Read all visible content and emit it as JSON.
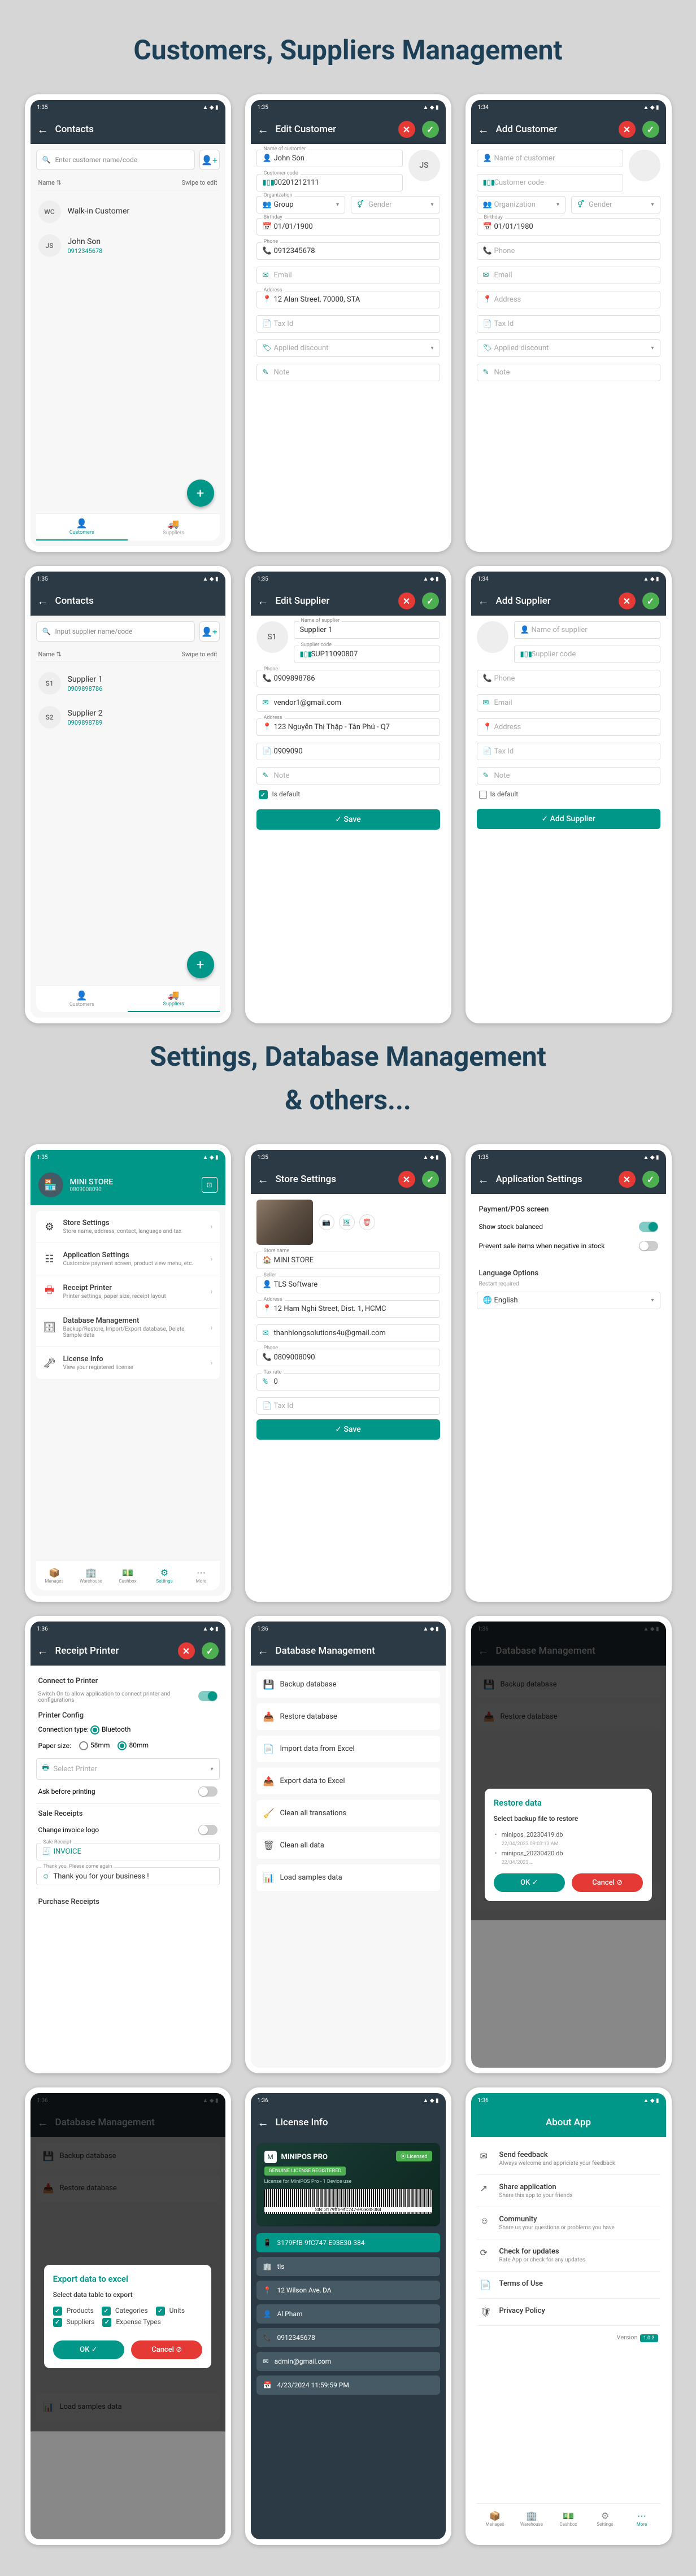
{
  "headers": {
    "section1": "Customers, Suppliers Management",
    "section2a": "Settings, Database Management",
    "section2b": "& others..."
  },
  "status": {
    "time": "1:35",
    "time2": "1:34",
    "time3": "1:36"
  },
  "contacts": {
    "title": "Contacts",
    "searchCustomer": "Enter customer name/code",
    "searchSupplier": "Input supplier name/code",
    "sortName": "Name ⇅",
    "swipe": "Swipe to edit",
    "customers": [
      {
        "initials": "WC",
        "name": "Walk-in Customer",
        "sub": ""
      },
      {
        "initials": "JS",
        "name": "John Son",
        "sub": "0912345678"
      }
    ],
    "suppliers": [
      {
        "initials": "S1",
        "name": "Supplier 1",
        "sub": "0909898786"
      },
      {
        "initials": "S2",
        "name": "Supplier 2",
        "sub": "0909898789"
      }
    ],
    "tabCustomers": "Customers",
    "tabSuppliers": "Suppliers"
  },
  "editCustomer": {
    "title": "Edit Customer",
    "name": "John Son",
    "code": "00201212111",
    "org": "Group",
    "gender": "Gender",
    "birthday": "01/01/1900",
    "phone": "0912345678",
    "email": "Email",
    "address": "12 Alan Street, 70000, STA",
    "taxId": "Tax Id",
    "discount": "Applied discount",
    "note": "Note",
    "avatar": "JS"
  },
  "addCustomer": {
    "title": "Add Customer",
    "name": "Name of customer",
    "code": "Customer code",
    "org": "Organization",
    "gender": "Gender",
    "birthday": "01/01/1980",
    "phone": "Phone",
    "email": "Email",
    "address": "Address",
    "taxId": "Tax Id",
    "discount": "Applied discount",
    "note": "Note"
  },
  "editSupplier": {
    "title": "Edit Supplier",
    "name": "Supplier 1",
    "code": "SUP11090807",
    "phone": "0909898786",
    "email": "vendor1@gmail.com",
    "address": "123 Nguyễn Thị Thập - Tân Phú - Q7",
    "taxId": "0909090",
    "note": "Note",
    "isDefault": "Is default",
    "save": "✓ Save",
    "avatar": "S1"
  },
  "addSupplier": {
    "title": "Add Supplier",
    "name": "Name of supplier",
    "code": "Supplier code",
    "phone": "Phone",
    "email": "Email",
    "address": "Address",
    "taxId": "Tax Id",
    "note": "Note",
    "isDefault": "Is default",
    "btn": "✓ Add Supplier"
  },
  "settings": {
    "store": "MINI STORE",
    "storeSub": "0809008090",
    "items": [
      {
        "icon": "⚙",
        "title": "Store Settings",
        "desc": "Store name, address, contact, language and tax"
      },
      {
        "icon": "☷",
        "title": "Application Settings",
        "desc": "Customize payment screen, product view menu, etc."
      },
      {
        "icon": "🖶",
        "title": "Receipt Printer",
        "desc": "Printer settings, paper size, receipt layout",
        "red": true
      },
      {
        "icon": "🗄",
        "title": "Database Management",
        "desc": "Backup/Restore, Import/Export database, Delete, Sample data"
      },
      {
        "icon": "🗝",
        "title": "License Info",
        "desc": "View your registered license"
      }
    ],
    "nav": [
      "Manages",
      "Warehouse",
      "Cashbox",
      "Settings",
      "More"
    ]
  },
  "storeSettings": {
    "title": "Store Settings",
    "storeName": "MINI STORE",
    "seller": "TLS Software",
    "address": "12 Ham Nghi Street, Dist. 1, HCMC",
    "email": "thanhlongsolutions4u@gmail.com",
    "phone": "0809008090",
    "taxRate": "0",
    "taxId": "Tax Id",
    "save": "✓ Save"
  },
  "appSettings": {
    "title": "Application Settings",
    "section1": "Payment/POS screen",
    "opt1": "Show stock balanced",
    "opt2": "Prevent sale items when negative in stock",
    "section2": "Language Options",
    "restart": "Restart required",
    "lang": "English"
  },
  "printer": {
    "title": "Receipt Printer",
    "connectHdr": "Connect to Printer",
    "connectDesc": "Switch On to allow application to connect printer and configurations",
    "configHdr": "Printer Config",
    "connType": "Connection type:",
    "bluetooth": "Bluetooth",
    "paperSize": "Paper size:",
    "p58": "58mm",
    "p80": "80mm",
    "selectPrinter": "Select Printer",
    "askBefore": "Ask before printing",
    "saleHdr": "Sale Receipts",
    "changeLogo": "Change invoice logo",
    "invoice": "INVOICE",
    "thankYou": "Thank you. Please come again",
    "thankMsg": "Thank you for your business !",
    "purchaseHdr": "Purchase Receipts"
  },
  "dbMgmt": {
    "title": "Database Management",
    "items": [
      "Backup database",
      "Restore database",
      "Import data from Excel",
      "Export data to Excel",
      "Clean all transations",
      "Clean all data",
      "Load samples data"
    ]
  },
  "restoreModal": {
    "title": "Restore data",
    "sub": "Select backup file to restore",
    "files": [
      "minipos_20230419.db",
      "22/04/2023 09:03:13 AM",
      "minipos_20230420.db",
      "22/04/2023…"
    ],
    "ok": "OK ✓",
    "cancel": "Cancel ⊘"
  },
  "exportModal": {
    "title": "Export data to excel",
    "sub": "Select data table to export",
    "items": [
      "Products",
      "Categories",
      "Units",
      "Suppliers",
      "Expense Types"
    ],
    "ok": "OK ✓",
    "cancel": "Cancel ⊘"
  },
  "license": {
    "title": "License Info",
    "brand": "MINIPOS PRO",
    "badge": "⦿ Licensed",
    "genuine": "GENUINE LICENSE REGISTERED",
    "desc": "License for MiniPOS Pro - 1 Device use",
    "barcode": "SIN: 3179ffb-9fC747-e93e30-384",
    "device": "3179FfB-9fC747-E93E30-384",
    "company": "tls",
    "address": "12 Wilson Ave, DA",
    "person": "Al Pham",
    "phone": "0912345678",
    "email": "admin@gmail.com",
    "date": "4/23/2024 11:59:59 PM"
  },
  "about": {
    "title": "About App",
    "items": [
      {
        "icon": "✉",
        "title": "Send feedback",
        "desc": "Always welcome and appriciate your feedback"
      },
      {
        "icon": "↗",
        "title": "Share application",
        "desc": "Share this app to your friends"
      },
      {
        "icon": "☺",
        "title": "Community",
        "desc": "Share us your questions or problems you have"
      },
      {
        "icon": "⟳",
        "title": "Check for updates",
        "desc": "Rate App or check for any updates"
      },
      {
        "icon": "📄",
        "title": "Terms of Use",
        "desc": ""
      },
      {
        "icon": "🛡",
        "title": "Privacy Policy",
        "desc": ""
      }
    ],
    "version": "Version",
    "versionNum": "1.0.3"
  },
  "labels": {
    "nameOfCustomer": "Name of customer",
    "customerCode": "Customer code",
    "organization": "Organization",
    "birthday": "Birthday",
    "phone": "Phone",
    "nameOfSupplier": "Name of supplier",
    "supplierCode": "Supplier code",
    "address": "Address",
    "storeName": "Store name",
    "seller": "Seller",
    "taxRate": "Tax rate",
    "saleReceipt": "Sale Receipt"
  }
}
